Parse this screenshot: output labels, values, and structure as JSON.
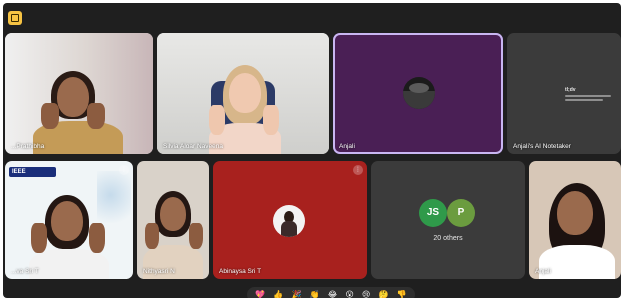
{
  "participants": {
    "t1": {
      "name": "...Prathibha"
    },
    "t2": {
      "name": "Silvia Aloar Naveena"
    },
    "t3": {
      "name": "Anjali"
    },
    "t4": {
      "name": "Anjali's AI Notetaker",
      "card_title": "tl;dv"
    },
    "t5": {
      "name": "...va Sri T",
      "badge": "IEEE"
    },
    "t6": {
      "name": "Nithyasri N"
    },
    "t7": {
      "name": "Abinaysa Sri T"
    },
    "t8": {
      "initials": [
        "JS",
        "P"
      ],
      "others": "20 others"
    },
    "t9": {
      "name": "Anjali"
    }
  },
  "reactions": [
    "💖",
    "👍",
    "🎉",
    "👏",
    "😂",
    "😮",
    "😢",
    "🤔",
    "👎"
  ],
  "colors": {
    "stage": "#1f1f1f",
    "accent_border": "#c9b6f2",
    "t3_bg": "#4a1f55",
    "t7_bg": "#a8211e",
    "initials_green": "#2f9a4a"
  }
}
